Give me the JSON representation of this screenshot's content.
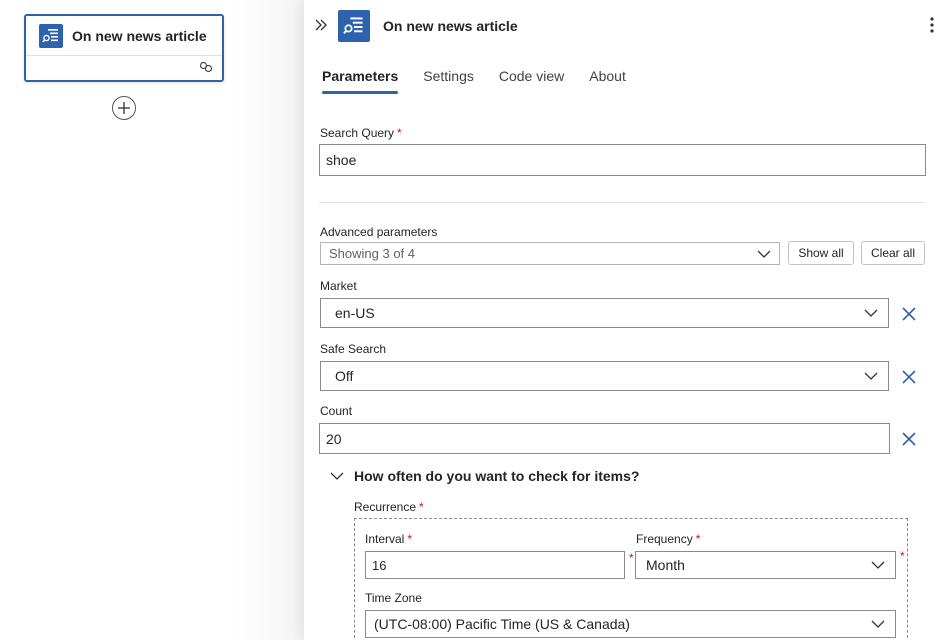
{
  "canvas": {
    "card_title": "On new news article",
    "card_icon": "news-search-icon",
    "link_icon": "link-icon",
    "add_icon": "plus-circle-icon"
  },
  "panel": {
    "title": "On new news article",
    "icon": "news-search-icon",
    "collapse_icon": "double-chevron-right-icon",
    "more_icon": "more-vertical-icon",
    "tabs": [
      {
        "label": "Parameters",
        "active": true
      },
      {
        "label": "Settings",
        "active": false
      },
      {
        "label": "Code view",
        "active": false
      },
      {
        "label": "About",
        "active": false
      }
    ]
  },
  "params": {
    "search_query": {
      "label": "Search Query",
      "required": "*",
      "value": "shoe"
    },
    "advanced": {
      "label": "Advanced parameters",
      "value": "Showing 3 of 4",
      "show_all": "Show all",
      "clear_all": "Clear all"
    },
    "market": {
      "label": "Market",
      "value": "en-US"
    },
    "safe_search": {
      "label": "Safe Search",
      "value": "Off"
    },
    "count": {
      "label": "Count",
      "value": "20"
    },
    "schedule_section": {
      "title": "How often do you want to check for items?"
    },
    "recurrence": {
      "label": "Recurrence",
      "required": "*",
      "interval": {
        "label": "Interval",
        "required": "*",
        "value": "16"
      },
      "frequency": {
        "label": "Frequency",
        "required": "*",
        "value": "Month"
      },
      "time_zone": {
        "label": "Time Zone",
        "value": "(UTC-08:00) Pacific Time (US & Canada)"
      }
    }
  },
  "colors": {
    "accent": "#2f62ad",
    "required": "#c50f1f"
  }
}
